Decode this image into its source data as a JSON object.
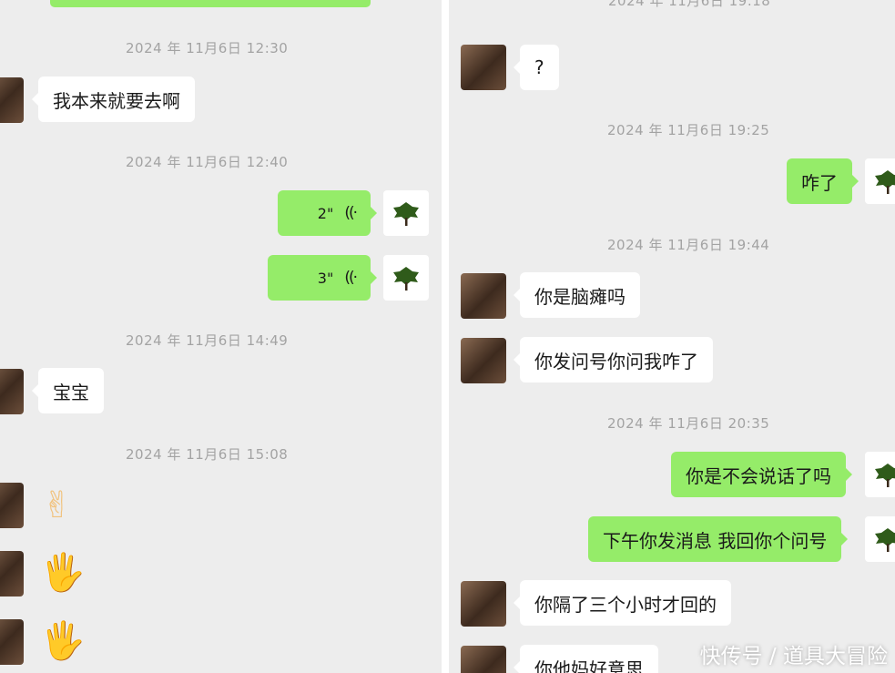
{
  "left": {
    "timestamps": [
      "2024 年 11月6日 12:30",
      "2024 年 11月6日 12:40",
      "2024 年 11月6日 14:49",
      "2024 年 11月6日 15:08"
    ],
    "messages": {
      "m1": "我本来就要去啊",
      "voice1": "2\"",
      "voice2": "3\"",
      "m2": "宝宝",
      "emoji1": "✌",
      "emoji2": "🖐",
      "emoji3": "🖐"
    }
  },
  "right": {
    "timestamps": [
      "2024 年 11月6日 19:25",
      "2024 年 11月6日 19:44",
      "2024 年 11月6日 20:35"
    ],
    "messages": {
      "q": "?",
      "zale": "咋了",
      "naotan": "你是脑瘫吗",
      "wenhao": "你发问号你问我咋了",
      "buhui": "你是不会说话了吗",
      "xiawu": "下午你发消息 我回你个问号",
      "gele": "你隔了三个小时才回的",
      "cutoff": "你他妈好意思"
    }
  },
  "voice_icon": "((·",
  "watermark": "快传号 / 道具大冒险",
  "colors": {
    "sent_bubble": "#95ec69",
    "received_bubble": "#ffffff",
    "background": "#ededed",
    "timestamp": "#a3a3a3"
  }
}
